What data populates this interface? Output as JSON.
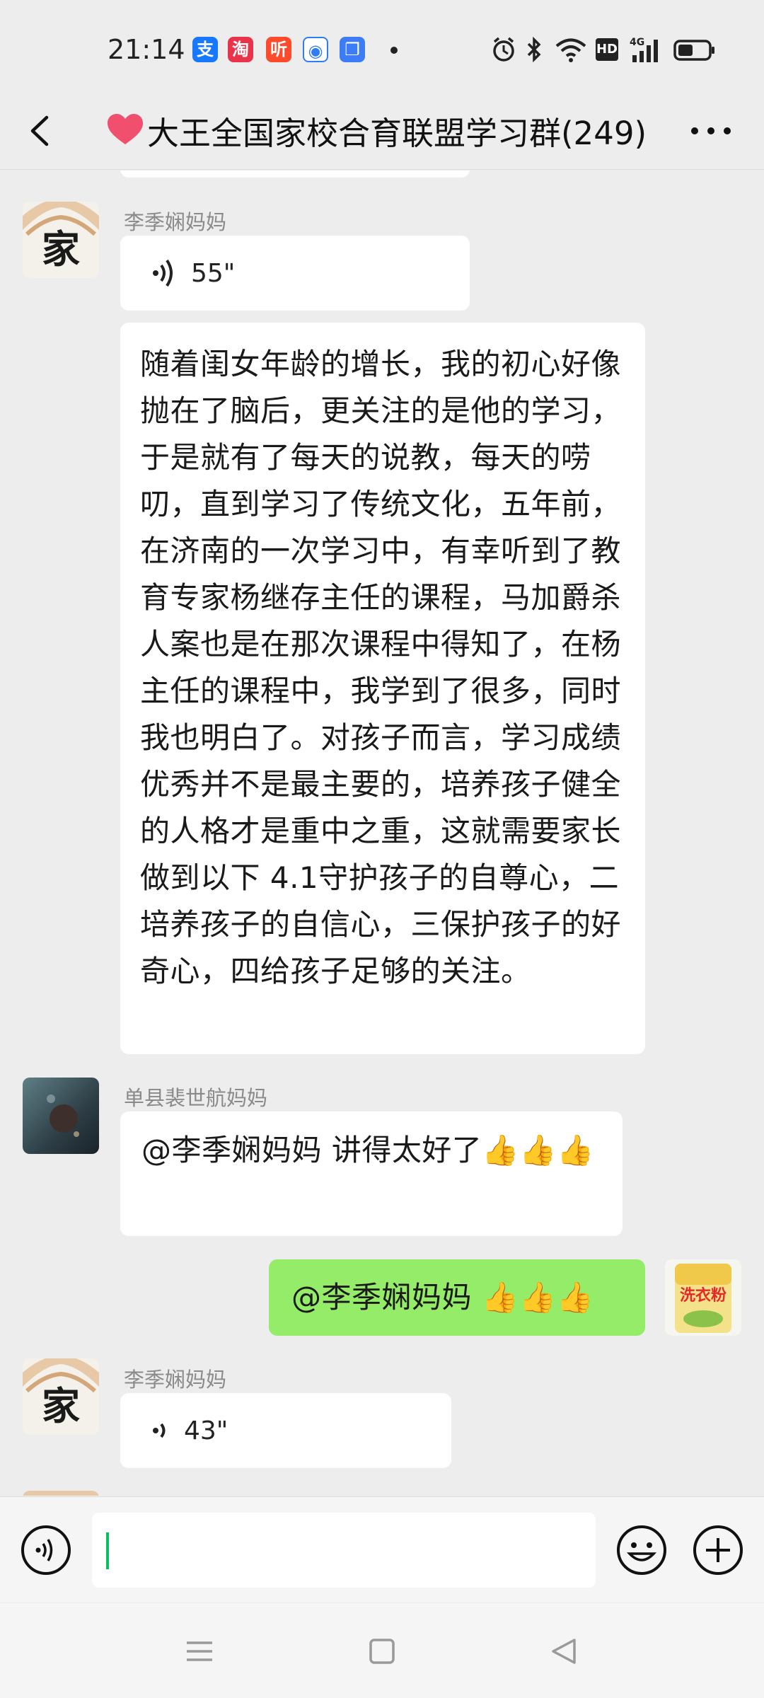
{
  "status_bar": {
    "time": "21:14",
    "apps": [
      {
        "icon": "alipay-icon",
        "glyph": "支",
        "color": "#1677ff"
      },
      {
        "icon": "mall-app-icon",
        "glyph": "淘",
        "color": "#e8334a"
      },
      {
        "icon": "audio-app-icon",
        "glyph": "听",
        "color": "#ff4b2b"
      },
      {
        "icon": "browser-app-icon",
        "glyph": "◉",
        "color": "#2f7df6"
      },
      {
        "icon": "window-app-icon",
        "glyph": "❐",
        "color": "#3d7cf7"
      }
    ],
    "right_icons": [
      "alarm-icon",
      "bluetooth-icon",
      "wifi-icon",
      "hd-icon",
      "4g-signal-icon",
      "battery-icon"
    ],
    "hd_label": "HD",
    "network_label": "4G"
  },
  "header": {
    "title": "大王全国家校合育联盟学习群(249)",
    "heart_color": "#f0506e"
  },
  "messages": [
    {
      "sender": "李季娴妈妈",
      "avatar_text": "家",
      "type": "voice",
      "duration": "55\""
    },
    {
      "type": "text",
      "text": "随着闺女年龄的增长，我的初心好像抛在了脑后，更关注的是他的学习，于是就有了每天的说教，每天的唠叨，直到学习了传统文化，五年前，在济南的一次学习中，有幸听到了教育专家杨继存主任的课程，马加爵杀人案也是在那次课程中得知了，在杨主任的课程中，我学到了很多，同时我也明白了。对孩子而言，学习成绩优秀并不是最主要的，培养孩子健全的人格才是重中之重，这就需要家长做到以下 4.1守护孩子的自尊心，二培养孩子的自信心，三保护孩子的好奇心，四给孩子足够的关注。"
    },
    {
      "sender": "单县裴世航妈妈",
      "type": "text",
      "text": "@李季娴妈妈  讲得太好了👍👍👍"
    },
    {
      "sender": "self",
      "type": "text",
      "text": "@李季娴妈妈 👍👍👍",
      "avatar_text": "洗衣粉"
    },
    {
      "sender": "李季娴妈妈",
      "avatar_text": "家",
      "type": "voice",
      "duration": "43\""
    }
  ],
  "input_bar": {
    "voice_button": "voice-input-icon",
    "emoji_button": "emoji-icon",
    "plus_button": "plus-icon",
    "text_value": ""
  },
  "nav_bar": [
    "menu-icon",
    "home-icon",
    "back-triangle-icon"
  ]
}
